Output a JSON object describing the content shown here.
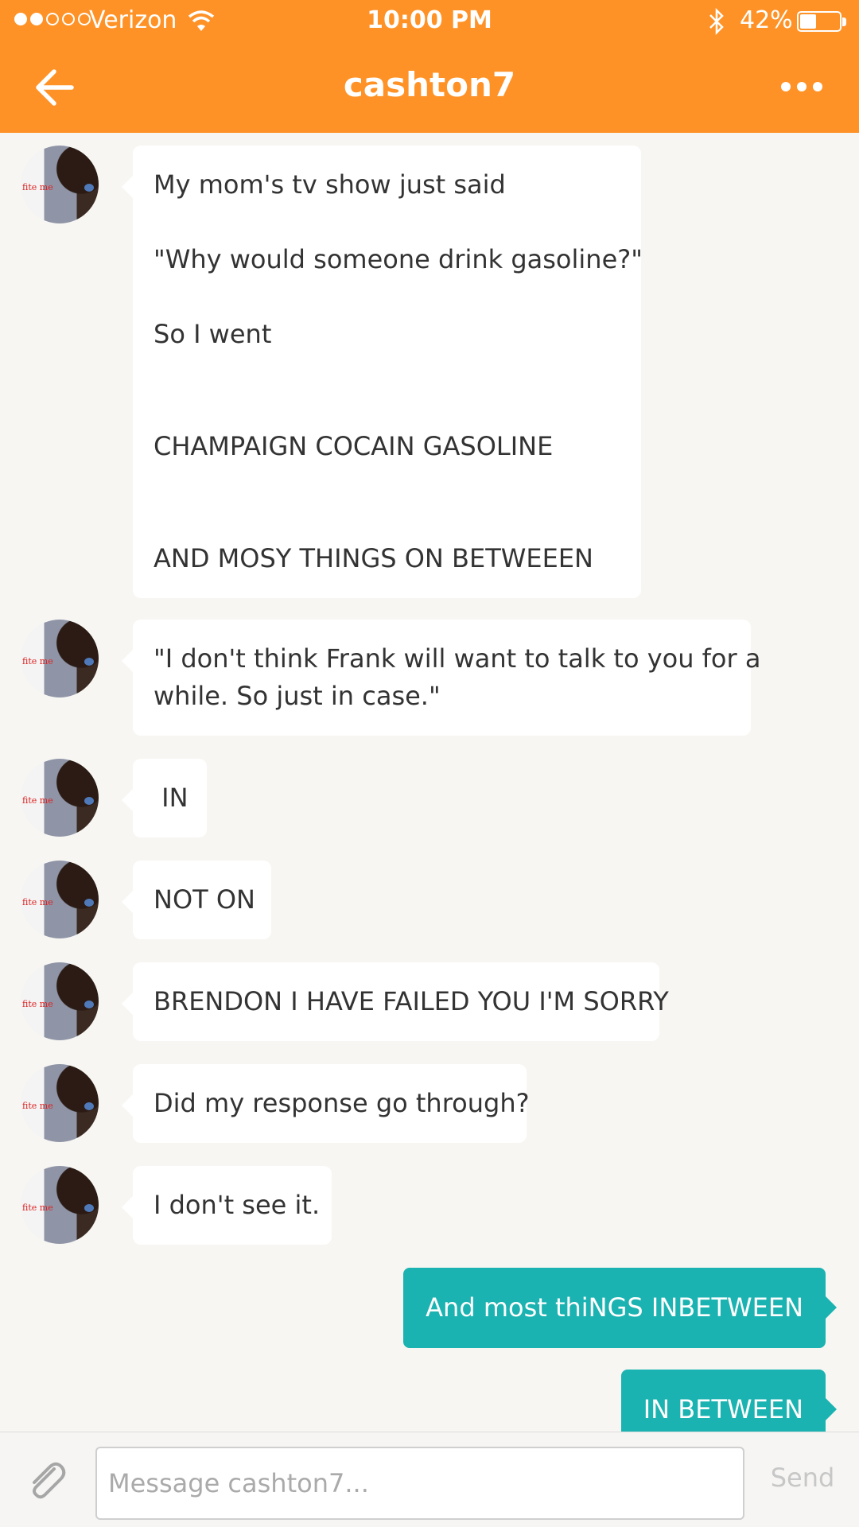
{
  "status_bar": {
    "carrier": "Verizon",
    "time": "10:00 PM",
    "battery_percent": "42%",
    "battery_level": 0.42,
    "signal_bars": 2,
    "signal_total": 5
  },
  "header": {
    "title": "cashton7",
    "back_icon": "arrow-left-icon",
    "more_icon": "more-dots-icon"
  },
  "avatar_text": "fite me",
  "messages_in": [
    {
      "lines": [
        "My mom's tv show just said",
        "",
        "\"Why would someone drink gasoline?\"",
        "",
        "So I went",
        "",
        "",
        "CHAMPAIGN COCAIN GASOLINE",
        "",
        "",
        "AND MOSY THINGS ON BETWEEEN"
      ]
    },
    {
      "lines": [
        "\"I don't think Frank will want to talk to you for a",
        "while. So just in case.\""
      ]
    },
    {
      "lines": [
        " IN"
      ]
    },
    {
      "lines": [
        "NOT ON"
      ]
    },
    {
      "lines": [
        "BRENDON I HAVE FAILED YOU I'M SORRY"
      ]
    },
    {
      "lines": [
        "Did my response go through?"
      ]
    },
    {
      "lines": [
        "I don't see it."
      ]
    }
  ],
  "messages_out": [
    {
      "text": "And most thiNGS INBETWEEN"
    },
    {
      "text": "IN BETWEEN"
    }
  ],
  "composer": {
    "placeholder": "Message cashton7...",
    "value": "",
    "send_label": "Send",
    "attach_icon": "paperclip-icon"
  },
  "colors": {
    "header": "#ff9226",
    "outgoing_bubble": "#1bb3b1",
    "background": "#f7f6f2"
  }
}
